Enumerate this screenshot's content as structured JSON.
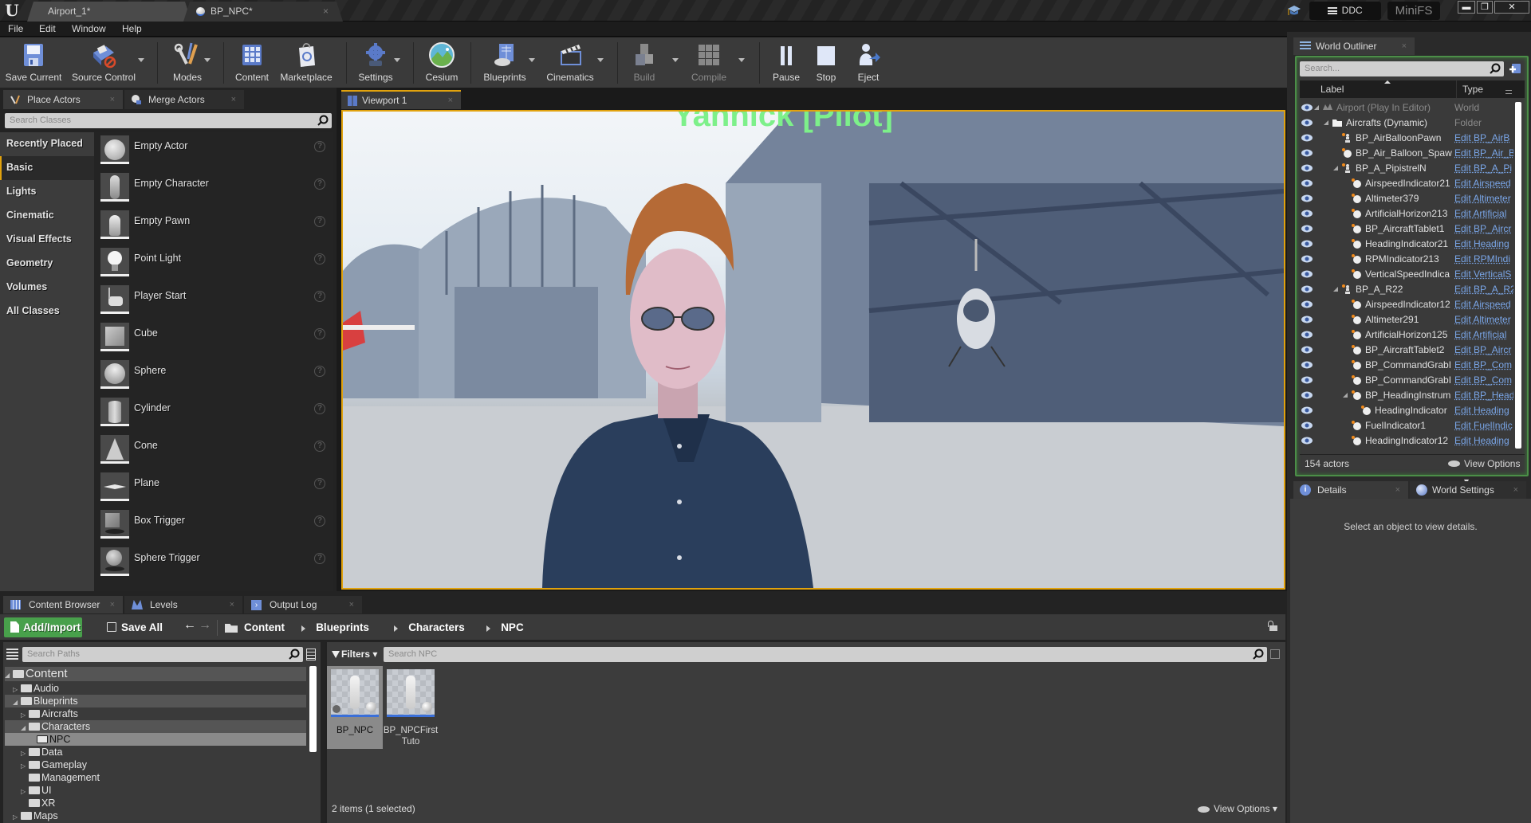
{
  "titlebar": {
    "document_tabs": [
      {
        "label": "Airport_1*",
        "active": true
      },
      {
        "label": "BP_NPC*",
        "active": false
      }
    ],
    "ddc_label": "DDC",
    "minifs_label": "MiniFS"
  },
  "menu": [
    "File",
    "Edit",
    "Window",
    "Help"
  ],
  "toolbar": [
    {
      "label": "Save Current",
      "icon": "save-icon",
      "dropdown": false,
      "enabled": true
    },
    {
      "label": "Source Control",
      "icon": "source-control-icon",
      "dropdown": true,
      "enabled": true
    },
    {
      "label": "Modes",
      "icon": "modes-icon",
      "dropdown": true,
      "enabled": true
    },
    {
      "label": "Content",
      "icon": "content-icon",
      "dropdown": false,
      "enabled": true
    },
    {
      "label": "Marketplace",
      "icon": "marketplace-icon",
      "dropdown": false,
      "enabled": true
    },
    {
      "label": "Settings",
      "icon": "settings-icon",
      "dropdown": true,
      "enabled": true
    },
    {
      "label": "Cesium",
      "icon": "cesium-icon",
      "dropdown": false,
      "enabled": true
    },
    {
      "label": "Blueprints",
      "icon": "blueprints-icon",
      "dropdown": true,
      "enabled": true
    },
    {
      "label": "Cinematics",
      "icon": "cinematics-icon",
      "dropdown": true,
      "enabled": true
    },
    {
      "label": "Build",
      "icon": "build-icon",
      "dropdown": true,
      "enabled": false
    },
    {
      "label": "Compile",
      "icon": "compile-icon",
      "dropdown": true,
      "enabled": false
    },
    {
      "label": "Pause",
      "icon": "pause-icon",
      "dropdown": false,
      "enabled": true
    },
    {
      "label": "Stop",
      "icon": "stop-icon",
      "dropdown": false,
      "enabled": true
    },
    {
      "label": "Eject",
      "icon": "eject-icon",
      "dropdown": false,
      "enabled": true
    }
  ],
  "place_actors": {
    "tabs": [
      {
        "label": "Place Actors"
      },
      {
        "label": "Merge Actors"
      }
    ],
    "search_placeholder": "Search Classes",
    "categories": [
      "Recently Placed",
      "Basic",
      "Lights",
      "Cinematic",
      "Visual Effects",
      "Geometry",
      "Volumes",
      "All Classes"
    ],
    "active_category": "Basic",
    "items": [
      "Empty Actor",
      "Empty Character",
      "Empty Pawn",
      "Point Light",
      "Player Start",
      "Cube",
      "Sphere",
      "Cylinder",
      "Cone",
      "Plane",
      "Box Trigger",
      "Sphere Trigger"
    ]
  },
  "viewport": {
    "tab_label": "Viewport 1",
    "overlay_text": "Yannick [Pilot]",
    "overlay_color": "#7df08a"
  },
  "outliner": {
    "tab_label": "World Outliner",
    "search_placeholder": "Search...",
    "columns": {
      "label": "Label",
      "type": "Type"
    },
    "rows": [
      {
        "label": "Airport (Play In Editor)",
        "type": "World",
        "depth": 0,
        "expanded": true,
        "kind": "world"
      },
      {
        "label": "Aircrafts (Dynamic)",
        "type": "Folder",
        "depth": 1,
        "expanded": true,
        "kind": "folder"
      },
      {
        "label": "BP_AirBalloonPawn",
        "type": "Edit BP_AirB",
        "depth": 2,
        "kind": "pawn"
      },
      {
        "label": "BP_Air_Balloon_Spaw",
        "type": "Edit BP_Air_B",
        "depth": 2,
        "kind": "actor"
      },
      {
        "label": "BP_A_PipistrelN",
        "type": "Edit BP_A_Pi",
        "depth": 2,
        "expanded": true,
        "kind": "pawn"
      },
      {
        "label": "AirspeedIndicator21",
        "type": "Edit Airspeed",
        "depth": 3,
        "kind": "actor"
      },
      {
        "label": "Altimeter379",
        "type": "Edit Altimeter",
        "depth": 3,
        "kind": "actor"
      },
      {
        "label": "ArtificialHorizon213",
        "type": "Edit Artificial",
        "depth": 3,
        "kind": "actor"
      },
      {
        "label": "BP_AircraftTablet1",
        "type": "Edit BP_Aircr",
        "depth": 3,
        "kind": "actor"
      },
      {
        "label": "HeadingIndicator21",
        "type": "Edit Heading",
        "depth": 3,
        "kind": "actor"
      },
      {
        "label": "RPMIndicator213",
        "type": "Edit RPMIndi",
        "depth": 3,
        "kind": "actor"
      },
      {
        "label": "VerticalSpeedIndica",
        "type": "Edit VerticalS",
        "depth": 3,
        "kind": "actor"
      },
      {
        "label": "BP_A_R22",
        "type": "Edit BP_A_R2",
        "depth": 2,
        "expanded": true,
        "kind": "pawn"
      },
      {
        "label": "AirspeedIndicator12",
        "type": "Edit Airspeed",
        "depth": 3,
        "kind": "actor"
      },
      {
        "label": "Altimeter291",
        "type": "Edit Altimeter",
        "depth": 3,
        "kind": "actor"
      },
      {
        "label": "ArtificialHorizon125",
        "type": "Edit Artificial",
        "depth": 3,
        "kind": "actor"
      },
      {
        "label": "BP_AircraftTablet2",
        "type": "Edit BP_Aircr",
        "depth": 3,
        "kind": "actor"
      },
      {
        "label": "BP_CommandGrabI",
        "type": "Edit BP_Com",
        "depth": 3,
        "kind": "actor"
      },
      {
        "label": "BP_CommandGrabI",
        "type": "Edit BP_Com",
        "depth": 3,
        "kind": "actor"
      },
      {
        "label": "BP_HeadingInstrum",
        "type": "Edit BP_Head",
        "depth": 3,
        "expanded": true,
        "kind": "actor"
      },
      {
        "label": "HeadingIndicator",
        "type": "Edit Heading",
        "depth": 4,
        "kind": "actor"
      },
      {
        "label": "FuelIndicator1",
        "type": "Edit FuelIndic",
        "depth": 3,
        "kind": "actor"
      },
      {
        "label": "HeadingIndicator12",
        "type": "Edit Heading",
        "depth": 3,
        "kind": "actor"
      }
    ],
    "actor_count": "154 actors",
    "view_options_label": "View Options"
  },
  "details": {
    "tabs": [
      {
        "label": "Details"
      },
      {
        "label": "World Settings"
      }
    ],
    "empty_message": "Select an object to view details."
  },
  "content_browser": {
    "tabs": [
      {
        "label": "Content Browser"
      },
      {
        "label": "Levels"
      },
      {
        "label": "Output Log"
      }
    ],
    "add_import_label": "Add/Import",
    "save_all_label": "Save All",
    "breadcrumb": [
      "Content",
      "Blueprints",
      "Characters",
      "NPC"
    ],
    "path_search_placeholder": "Search Paths",
    "filters_label": "Filters",
    "asset_search_placeholder": "Search NPC",
    "tree": [
      {
        "label": "Content",
        "depth": 0,
        "expanded": true,
        "has_children": true,
        "state": "root"
      },
      {
        "label": "Audio",
        "depth": 1,
        "expanded": false,
        "has_children": true
      },
      {
        "label": "Blueprints",
        "depth": 1,
        "expanded": true,
        "has_children": true,
        "state": "open"
      },
      {
        "label": "Aircrafts",
        "depth": 2,
        "expanded": false,
        "has_children": true
      },
      {
        "label": "Characters",
        "depth": 2,
        "expanded": true,
        "has_children": true,
        "state": "open"
      },
      {
        "label": "NPC",
        "depth": 3,
        "has_children": false,
        "state": "selected"
      },
      {
        "label": "Data",
        "depth": 2,
        "expanded": false,
        "has_children": true
      },
      {
        "label": "Gameplay",
        "depth": 2,
        "expanded": false,
        "has_children": true
      },
      {
        "label": "Management",
        "depth": 2,
        "has_children": false
      },
      {
        "label": "UI",
        "depth": 2,
        "expanded": false,
        "has_children": true
      },
      {
        "label": "XR",
        "depth": 2,
        "has_children": false
      },
      {
        "label": "Maps",
        "depth": 1,
        "expanded": false,
        "has_children": true
      }
    ],
    "assets": [
      {
        "label": "BP_NPC",
        "selected": true
      },
      {
        "label": "BP_NPCFirstTuto",
        "display": "BP_NPCFirst Tuto",
        "selected": false
      }
    ],
    "status": "2 items (1 selected)",
    "view_options_label": "View Options"
  },
  "colors": {
    "accent_orange": "#e1a20d",
    "add_import_green": "#48a04b",
    "outliner_border_green": "#4b8e48",
    "link_blue": "#7aa6e8",
    "asset_bar_blue": "#3a6fd8"
  }
}
